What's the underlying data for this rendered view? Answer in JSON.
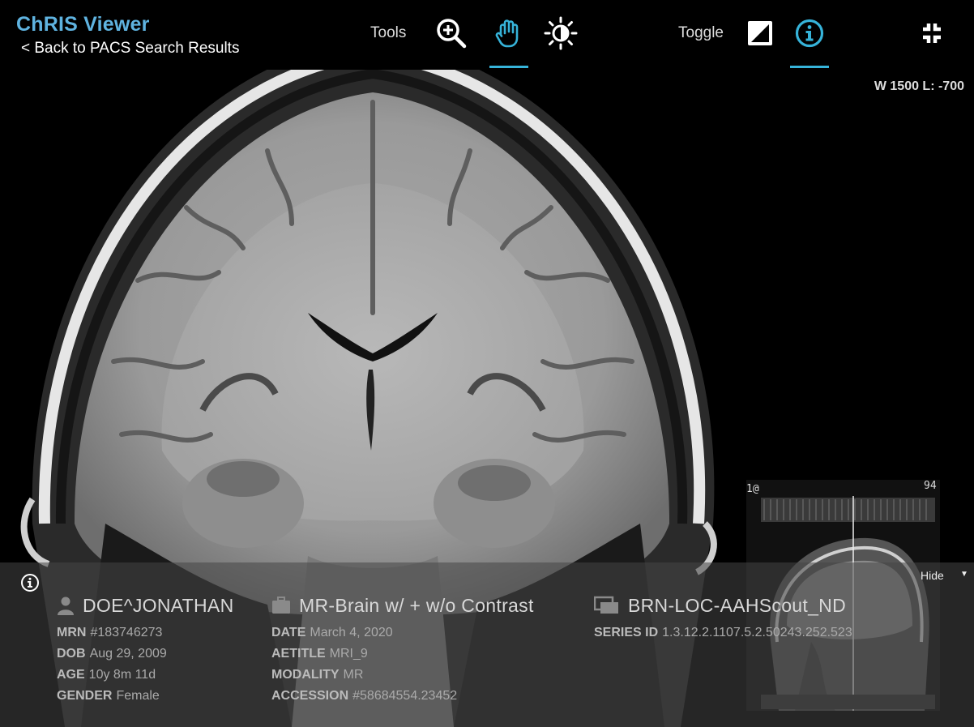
{
  "header": {
    "app_title": "ChRIS Viewer",
    "back_link": "< Back to PACS Search Results",
    "tools_label": "Tools",
    "toggle_label": "Toggle"
  },
  "tools": [
    "zoom-in-icon",
    "pan-hand-icon",
    "brightness-icon"
  ],
  "active_tool": "pan-hand-icon",
  "toggles": [
    "contrast-toggle-icon",
    "info-icon"
  ],
  "active_toggle": "info-icon",
  "fullscreen_icon": "collapse-fullscreen-icon",
  "window_level": "W 1500 L: -700",
  "thumbnail": {
    "label_left": "1@",
    "label_right": "94"
  },
  "info_panel": {
    "hide_label": "Hide",
    "patient": {
      "name": "DOE^JONATHAN",
      "mrn_label": "MRN",
      "mrn": "#183746273",
      "dob_label": "DOB",
      "dob": "Aug 29, 2009",
      "age_label": "AGE",
      "age": "10y  8m  11d",
      "gender_label": "GENDER",
      "gender": "Female"
    },
    "study": {
      "description": "MR-Brain w/ + w/o Contrast",
      "date_label": "DATE",
      "date": "March 4, 2020",
      "aetitle_label": "AETITLE",
      "aetitle": "MRI_9",
      "modality_label": "MODALITY",
      "modality": "MR",
      "accession_label": "ACCESSION",
      "accession": "#58684554.23452"
    },
    "series": {
      "description": "BRN-LOC-AAHScout_ND",
      "series_id_label": "SERIES ID",
      "series_id": "1.3.12.2.1107.5.2.50243.252.523"
    }
  },
  "colors": {
    "accent": "#36b3d9",
    "title": "#5fb3e0"
  }
}
